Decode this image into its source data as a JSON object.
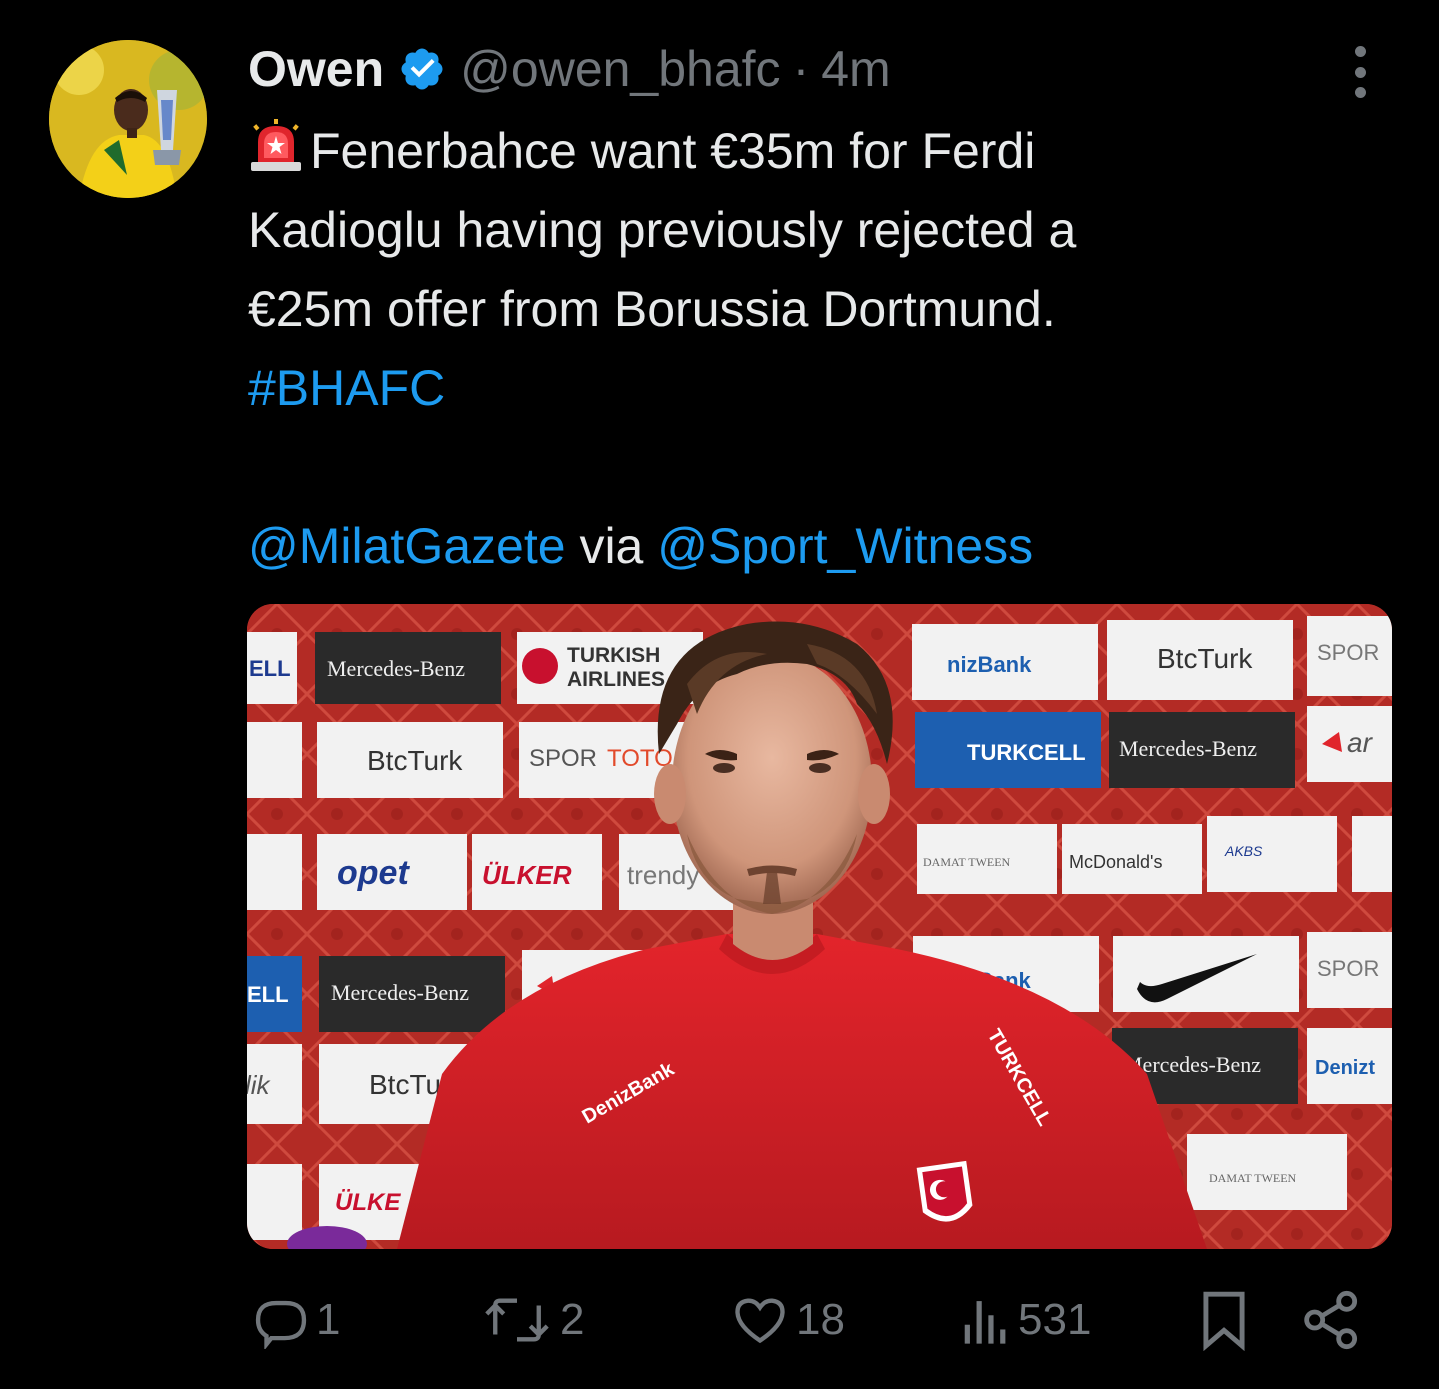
{
  "author": {
    "display_name": "Owen",
    "handle": "@owen_bhafc",
    "separator": "·",
    "timestamp": "4m",
    "verified": true,
    "avatar": "avatar-image"
  },
  "tweet": {
    "line1": "Fenerbahce want €35m for Ferdi",
    "line2": "Kadioglu having previously rejected a",
    "line3": "€25m offer from Borussia Dortmund.",
    "hashtag": "#BHAFC",
    "mention1": "@MilatGazete",
    "via": "via",
    "mention2": "@Sport_Witness",
    "emoji": "siren-icon"
  },
  "media": {
    "type": "photo",
    "sponsor_board": {
      "row1": [
        "ELL",
        "Mercedes-Benz",
        "TURKISH",
        "AIRLINES",
        "nizBank",
        "BtcTurk",
        "SPOR"
      ],
      "row2": [
        "BtcTurk",
        "SPOR",
        "TOTO",
        "TURKCELL",
        "Mercedes-Benz",
        "ar"
      ],
      "row3": [
        "opet",
        "ÜLKER",
        "trendy",
        "DAMAT TWEEN",
        "McDonald's",
        "AKBS"
      ],
      "row4": [
        "ELL",
        "Mercedes-Benz",
        "arcelik",
        "Bank",
        "SPOR"
      ],
      "row5": [
        "lik",
        "BtcTurk",
        "Mercedes-Benz",
        "Denizt"
      ],
      "row6": [
        "ÜLKE",
        "DAMAT TWEEN"
      ]
    },
    "shirt_text": {
      "sponsor_left": "DenizBank",
      "sponsor_right": "TURKCELL"
    }
  },
  "actions": {
    "replies": "1",
    "reposts": "2",
    "likes": "18",
    "views": "531"
  },
  "colors": {
    "background": "#000000",
    "text": "#e7e9ea",
    "secondary": "#71767b",
    "link": "#1d9bf0",
    "verified": "#1d9bf0"
  }
}
